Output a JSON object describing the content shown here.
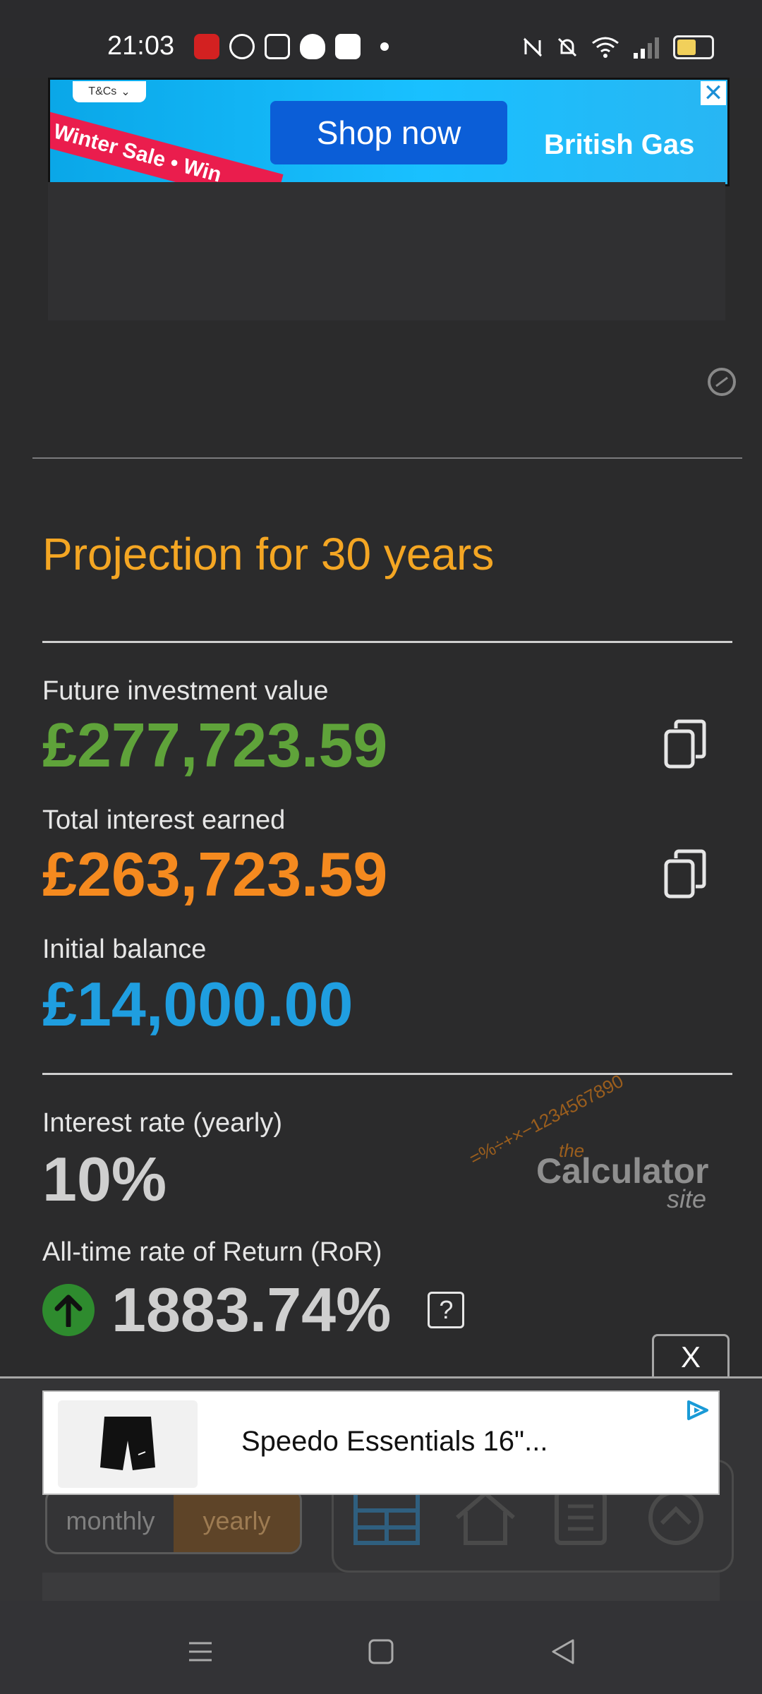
{
  "status_bar": {
    "time": "21:03",
    "left_icons": [
      "pdf-icon",
      "messenger-icon",
      "instagram-icon",
      "reddit-icon",
      "linkedin-icon",
      "dot-icon"
    ],
    "right_icons": [
      "nfc-icon",
      "mute-icon",
      "wifi-icon",
      "signal-icon",
      "battery-icon"
    ]
  },
  "top_ad": {
    "tcs_label": "T&Cs",
    "banner_text": "Winter Sale • Win",
    "button_label": "Shop now",
    "brand": "British Gas",
    "close_label": "✕"
  },
  "projection": {
    "title": "Projection for 30 years",
    "future_value_label": "Future investment value",
    "future_value": "£277,723.59",
    "interest_label": "Total interest earned",
    "interest_value": "£263,723.59",
    "initial_label": "Initial balance",
    "initial_value": "£14,000.00",
    "rate_label": "Interest rate (yearly)",
    "rate_value": "10%",
    "ror_label": "All-time rate of Return (RoR)",
    "ror_value": "1883.74%",
    "help_label": "?"
  },
  "watermark": {
    "digits": "=%÷+×−1234567890",
    "the": "the",
    "name": "Calculator",
    "site": "site"
  },
  "bottom_controls": {
    "close_label": "X",
    "toggle_monthly": "monthly",
    "toggle_yearly": "yearly"
  },
  "bottom_ad": {
    "product_title": "Speedo Essentials 16\"..."
  },
  "colors": {
    "title": "#f4a623",
    "future_value": "#5fa33a",
    "interest": "#f58a1f",
    "initial": "#1f9ee0",
    "up_arrow": "#2e8b2e"
  }
}
